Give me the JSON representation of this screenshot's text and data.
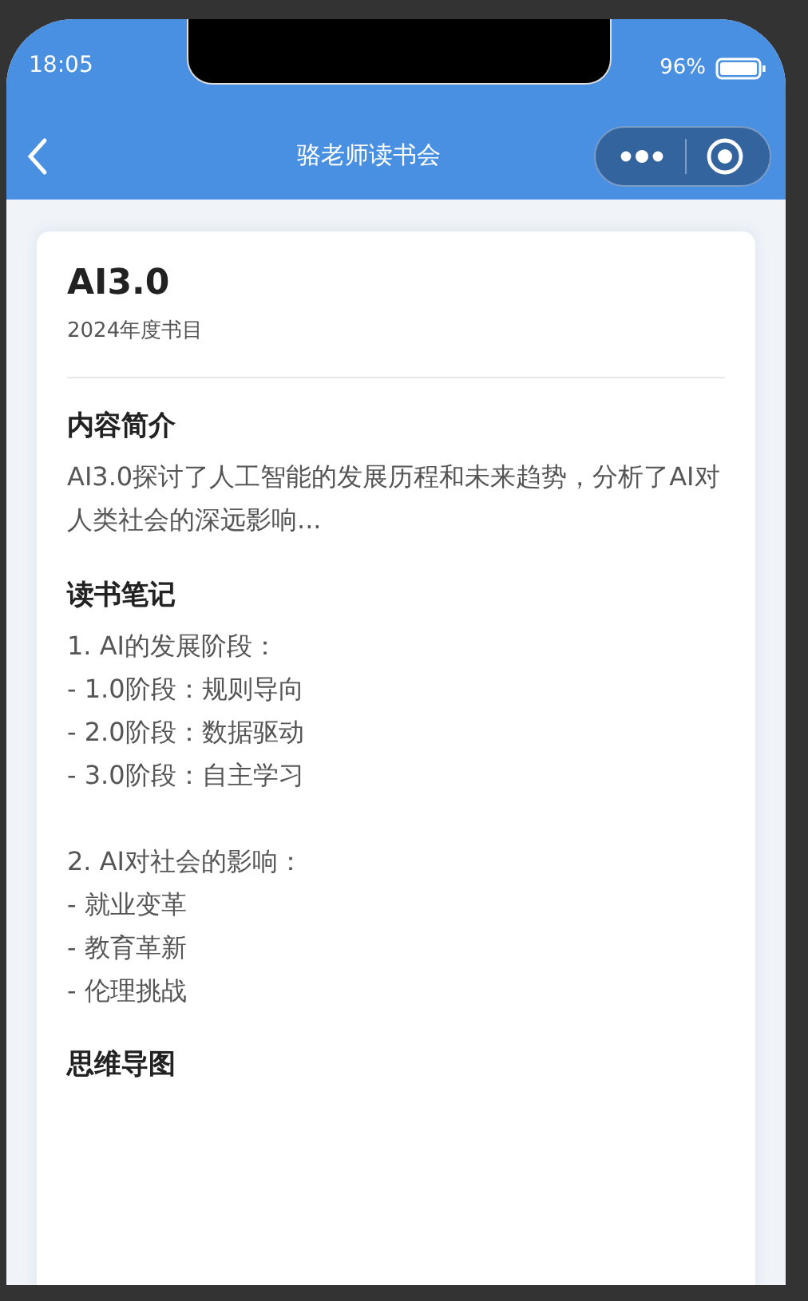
{
  "status_bar": {
    "time": "18:05",
    "battery": "96%"
  },
  "nav": {
    "title": "骆老师读书会"
  },
  "book": {
    "title": "AI3.0",
    "subtitle": "2024年度书目"
  },
  "sections": [
    {
      "heading": "内容简介",
      "kind": "paragraph",
      "text": "AI3.0探讨了人工智能的发展历程和未来趋势，分析了AI对人类社会的深远影响..."
    },
    {
      "heading": "读书笔记",
      "kind": "notes",
      "groups": [
        [
          "1. AI的发展阶段：",
          "- 1.0阶段：规则导向",
          "- 2.0阶段：数据驱动",
          "- 3.0阶段：自主学习"
        ],
        [
          "2. AI对社会的影响：",
          "- 就业变革",
          "- 教育革新",
          "- 伦理挑战"
        ]
      ]
    },
    {
      "heading": "思维导图",
      "kind": "empty"
    }
  ]
}
